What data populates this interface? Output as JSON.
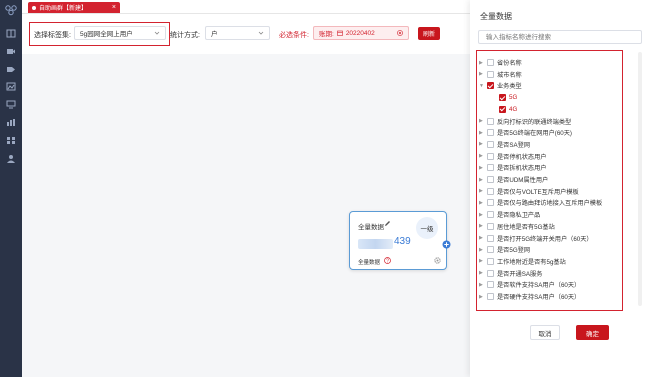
{
  "tab": {
    "label": "自助画群【新建】",
    "close": "×"
  },
  "filters": {
    "tag_label": "选择标签集:",
    "tag_value": "5g园网全网上用户",
    "stat_label": "统计方式:",
    "stat_value": "户",
    "required_label": "必选条件:",
    "account_period_label": "账期:",
    "account_period_value": "20220402",
    "query_button": "刷新"
  },
  "node": {
    "title": "全量数据",
    "value": "439",
    "level": "一级",
    "subtitle": "全量数据"
  },
  "drawer": {
    "title": "全量数据",
    "search_placeholder": "输入指标名称进行搜索",
    "items": [
      {
        "label": "省份名称",
        "checked": false,
        "expanded": false,
        "indent": 0
      },
      {
        "label": "城市名称",
        "checked": false,
        "expanded": false,
        "indent": 0
      },
      {
        "label": "业务类型",
        "checked": true,
        "expanded": true,
        "indent": 0
      },
      {
        "label": "5G",
        "checked": true,
        "expanded": false,
        "indent": 1
      },
      {
        "label": "4G",
        "checked": true,
        "expanded": false,
        "indent": 1
      },
      {
        "label": "反向打标识的联通终端类型",
        "checked": false,
        "expanded": false,
        "indent": 0
      },
      {
        "label": "是否5G终端在网用户(60天)",
        "checked": false,
        "expanded": false,
        "indent": 0
      },
      {
        "label": "是否SA登网",
        "checked": false,
        "expanded": false,
        "indent": 0
      },
      {
        "label": "是否停机状态用户",
        "checked": false,
        "expanded": false,
        "indent": 0
      },
      {
        "label": "是否拆机状态用户",
        "checked": false,
        "expanded": false,
        "indent": 0
      },
      {
        "label": "是否UDM属性用户",
        "checked": false,
        "expanded": false,
        "indent": 0
      },
      {
        "label": "是否仅与VOLTE互斥用户模板",
        "checked": false,
        "expanded": false,
        "indent": 0
      },
      {
        "label": "是否仅与路由拜访地接入互斥用户模板",
        "checked": false,
        "expanded": false,
        "indent": 0
      },
      {
        "label": "是否隐私卫产品",
        "checked": false,
        "expanded": false,
        "indent": 0
      },
      {
        "label": "居住地是否有5G基站",
        "checked": false,
        "expanded": false,
        "indent": 0
      },
      {
        "label": "是否打开5G终端开关用户（60天）",
        "checked": false,
        "expanded": false,
        "indent": 0
      },
      {
        "label": "是否5G登网",
        "checked": false,
        "expanded": false,
        "indent": 0
      },
      {
        "label": "工作地附近是否有5g基站",
        "checked": false,
        "expanded": false,
        "indent": 0
      },
      {
        "label": "是否开通SA服务",
        "checked": false,
        "expanded": false,
        "indent": 0
      },
      {
        "label": "是否软件支持SA用户（60天）",
        "checked": false,
        "expanded": false,
        "indent": 0
      },
      {
        "label": "是否硬件支持SA用户（60天）",
        "checked": false,
        "expanded": false,
        "indent": 0
      }
    ],
    "cancel_button": "取消",
    "ok_button": "确定"
  },
  "colors": {
    "accent": "#c8161d",
    "sidebar": "#2a3347",
    "link": "#3a7bd5"
  }
}
